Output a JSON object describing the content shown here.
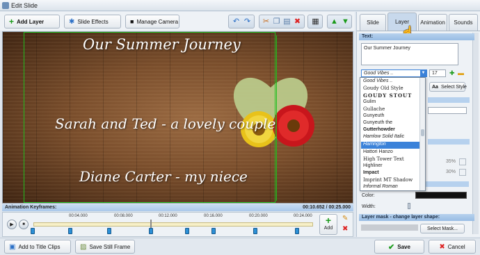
{
  "window": {
    "title": "Edit Slide"
  },
  "toolbar": {
    "add_layer": "Add Layer",
    "slide_effects": "Slide Effects",
    "manage_camera": "Manage Camera"
  },
  "canvas": {
    "line1": "Our Summer Journey",
    "line2": "Sarah and Ted - a lovely couple",
    "line3": "Diane Carter - my niece"
  },
  "timeline": {
    "title": "Animation Keyframes:",
    "time": "00:10.652 / 00:25.000",
    "ticks": [
      "00:04.000",
      "00:08.000",
      "00:12.000",
      "00:16.000",
      "00:20.000",
      "00:24.000"
    ],
    "add_label": "Add"
  },
  "bottom": {
    "add_to_title_clips": "Add to Title Clips",
    "save_still_frame": "Save Still Frame",
    "save": "Save",
    "cancel": "Cancel"
  },
  "panel": {
    "tabs": [
      "Slide",
      "Layer",
      "Animation",
      "Sounds"
    ],
    "text_section": "Text:",
    "text_value": "Our Summer Journey",
    "font_value": "Good Vibes ..",
    "font_size": "17",
    "select_style": "Select Style",
    "fonts": [
      "Good Vibes ..",
      "Goudy Old Style",
      "GOUDY STOUT",
      "Gulim",
      "Gullache",
      "Gunyeuth",
      "Gunyeuth the",
      "Gutterhowder",
      "Hamlow Solid Italic",
      "Harrington",
      "Hattori Hanzo",
      "High Tower Text",
      "Highliner",
      "Impact",
      "Imprint MT Shadow",
      "Informal Roman"
    ],
    "selected_font_index": 9,
    "pct1": "35%",
    "pct2": "30%",
    "color_label": "Color:",
    "width_label": "Width:",
    "mask_section": "Layer mask - change layer shape:",
    "select_mask": "Select Mask..."
  },
  "colors": {
    "accent": "#3b82d9",
    "panel_header": "#a9c8ea"
  }
}
